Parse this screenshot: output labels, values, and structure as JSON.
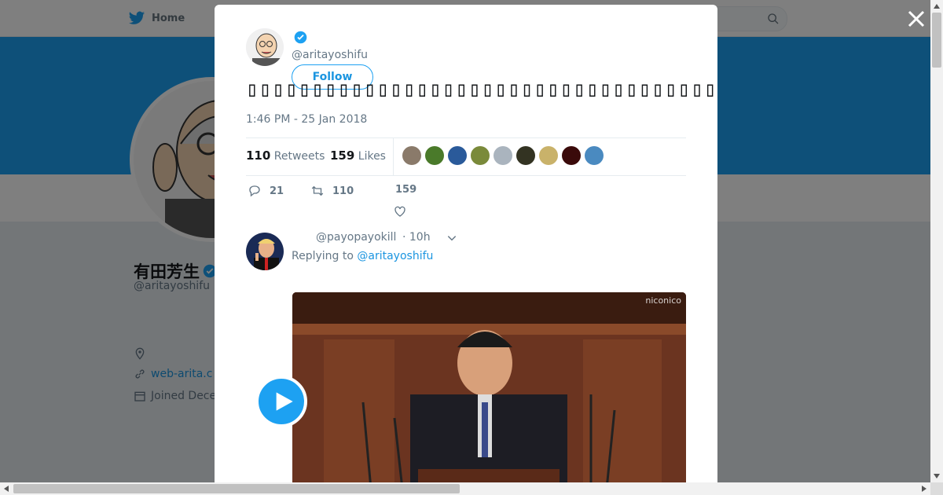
{
  "background_page": {
    "nav_home_label": "Home",
    "profile_name": "有田芳生",
    "profile_handle": "@aritayoshifu",
    "profile_website": "web-arita.c",
    "profile_joined": "Joined Dece"
  },
  "modal": {
    "author_handle": "@aritayoshifu",
    "follow_label": "Follow",
    "tweet_text": "▯▯▯▯▯▯▯▯▯▯▯▯▯▯▯▯▯▯▯▯▯▯▯▯▯▯▯▯▯▯▯▯▯▯▯▯▯▯▯▯▯▯▯▯▯▯▯▯▯▯▯▯▯▯▯▯▯▯▯▯▯▯▯▯▯",
    "timestamp": "1:46 PM - 25 Jan 2018",
    "retweets_count": "110",
    "retweets_label": "Retweets",
    "likes_count": "159",
    "likes_label": "Likes",
    "liker_colors": [
      "#8a7a6a",
      "#4a7a2a",
      "#2a5a9a",
      "#7a8a3a",
      "#aab4be",
      "#333322",
      "#c9b26a",
      "#3a0a0a",
      "#4a8ac0"
    ],
    "actions": {
      "reply_count": "21",
      "retweet_count": "110",
      "like_count": "159"
    },
    "reply": {
      "username": "@payopayokill",
      "time": "· 10h",
      "replying_prefix": "Replying to",
      "replying_to": "@aritayoshifu",
      "video_watermark": "niconico"
    }
  },
  "colors": {
    "accent": "#1da1f2",
    "link": "#1b95e0",
    "muted": "#657786"
  }
}
